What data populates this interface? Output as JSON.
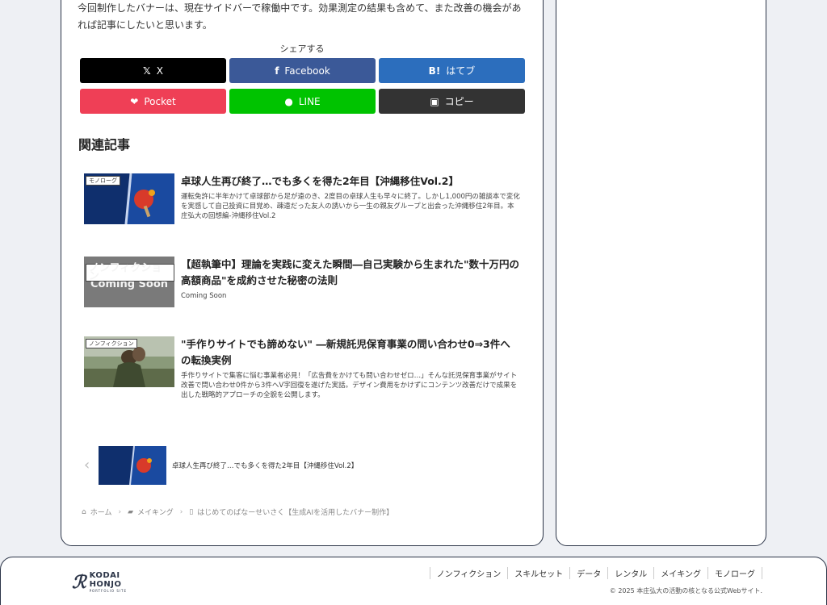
{
  "article": {
    "intro": "今回制作したバナーは、現在サイドバーで稼働中です。効果測定の結果も含めて、また改善の機会があれば記事にしたいと思います。"
  },
  "share": {
    "title": "シェアする",
    "buttons": [
      {
        "label": "X",
        "icon": "x-logo-icon",
        "icon_glyph": "𝕏",
        "color": "#000000"
      },
      {
        "label": "Facebook",
        "icon": "facebook-icon",
        "icon_glyph": "f",
        "color": "#3b5998"
      },
      {
        "label": "はてブ",
        "icon": "hatena-bookmark-icon",
        "icon_glyph": "B!",
        "color": "#2c6ebd"
      },
      {
        "label": "Pocket",
        "icon": "pocket-icon",
        "icon_glyph": "❤",
        "color": "#ef3f56"
      },
      {
        "label": "LINE",
        "icon": "line-icon",
        "icon_glyph": "●",
        "color": "#00c300"
      },
      {
        "label": "コピー",
        "icon": "copy-icon",
        "icon_glyph": "▣",
        "color": "#333333"
      }
    ]
  },
  "related": {
    "heading": "関連記事",
    "items": [
      {
        "category": "モノローグ",
        "title": "卓球人生再び終了…でも多くを得た2年目【沖縄移住Vol.2】",
        "description": "運転免許に半年かけて卓球部から足が遠のき、2度目の卓球人生も早々に終了。しかし1,000円の雑談本で変化を実感して自己投資に目覚め、疎遠だった友人の誘いから一生の親友グループと出会った沖縄移住2年目。本庄弘大の回想編-沖縄移住Vol.2"
      },
      {
        "category": "ノンフィクション",
        "title": "【超執筆中】理論を実践に変えた瞬間―自己実験から生まれた\"数十万円の高額商品\"を成約させた秘密の法則",
        "description": "Coming Soon",
        "thumb_text": "Coming Soon"
      },
      {
        "category": "ノンフィクション",
        "title": "\"手作りサイトでも諦めない\" ―新規託児保育事業の問い合わせ0⇒3件への転換実例",
        "description": "手作りサイトで集客に悩む事業者必見！「広告費をかけても問い合わせゼロ…」そんな託児保育事業がサイト改善で問い合わせ0件から3件へV字回復を遂げた実話。デザイン費用をかけずにコンテンツ改善だけで成果を出した戦略的アプローチの全貌を公開します。"
      }
    ]
  },
  "prev_post": {
    "title": "卓球人生再び終了…でも多くを得た2年目【沖縄移住Vol.2】"
  },
  "breadcrumb": {
    "home": "ホーム",
    "category": "メイキング",
    "current": "はじめてのばなーせいさく【生成AIを活用したバナー制作】"
  },
  "footer": {
    "logo_line1": "KODAI",
    "logo_line2": "HONJO",
    "logo_sub": "PORTFOLIO SITE",
    "nav": [
      "ノンフィクション",
      "スキルセット",
      "データ",
      "レンタル",
      "メイキング",
      "モノローグ"
    ],
    "copyright": "© 2025 本庄弘大の活動の核となる公式Webサイト."
  }
}
